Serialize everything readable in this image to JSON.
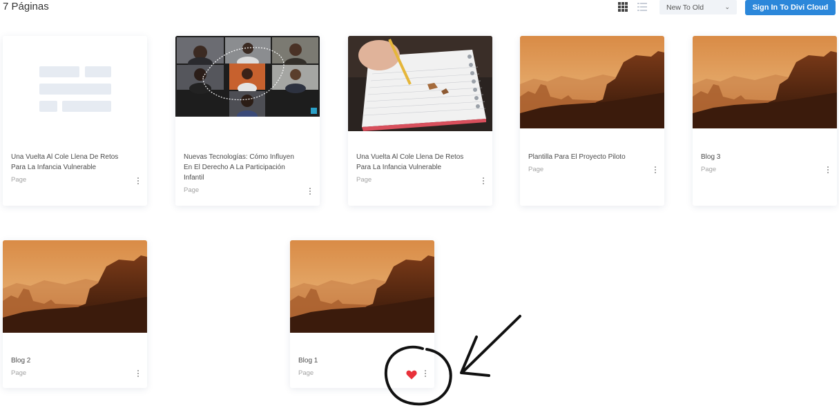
{
  "header": {
    "page_count": "7 Páginas",
    "sort_value": "New To Old",
    "signin_label": "Sign In To Divi Cloud"
  },
  "icons": {
    "grid_view": "grid-icon",
    "list_view": "list-icon",
    "sort_arrow": "chevron-down-icon",
    "more": "more-vertical-icon",
    "favorite": "heart-icon"
  },
  "colors": {
    "accent": "#2b87da",
    "heart": "#e8313a",
    "desert_sky": "#d88a40",
    "desert_dark": "#3b1b0c"
  },
  "cards": [
    {
      "title_line1": "Una Vuelta Al Cole Llena De Retos",
      "title_line2": "Para La Infancia Vulnerable",
      "title_line3": "",
      "type": "Page",
      "thumbnail": "placeholder-layout"
    },
    {
      "title_line1": "Nuevas Tecnologías: Cómo Influyen",
      "title_line2": "En El Derecho A La Participación",
      "title_line3": "Infantil",
      "type": "Page",
      "thumbnail": "video-call-grid"
    },
    {
      "title_line1": "Una Vuelta Al Cole Llena De Retos",
      "title_line2": "Para La Infancia Vulnerable",
      "title_line3": "",
      "type": "Page",
      "thumbnail": "pencil-notebook"
    },
    {
      "title_line1": "Plantilla Para El Proyecto Piloto",
      "title_line2": "",
      "title_line3": "",
      "type": "Page",
      "thumbnail": "desert-landscape"
    },
    {
      "title_line1": "Blog 3",
      "title_line2": "",
      "title_line3": "",
      "type": "Page",
      "thumbnail": "desert-landscape"
    },
    {
      "title_line1": "Blog 2",
      "title_line2": "",
      "title_line3": "",
      "type": "Page",
      "thumbnail": "desert-landscape"
    },
    {
      "title_line1": "Blog 1",
      "title_line2": "",
      "title_line3": "",
      "type": "Page",
      "thumbnail": "desert-landscape",
      "favorited": true
    }
  ]
}
